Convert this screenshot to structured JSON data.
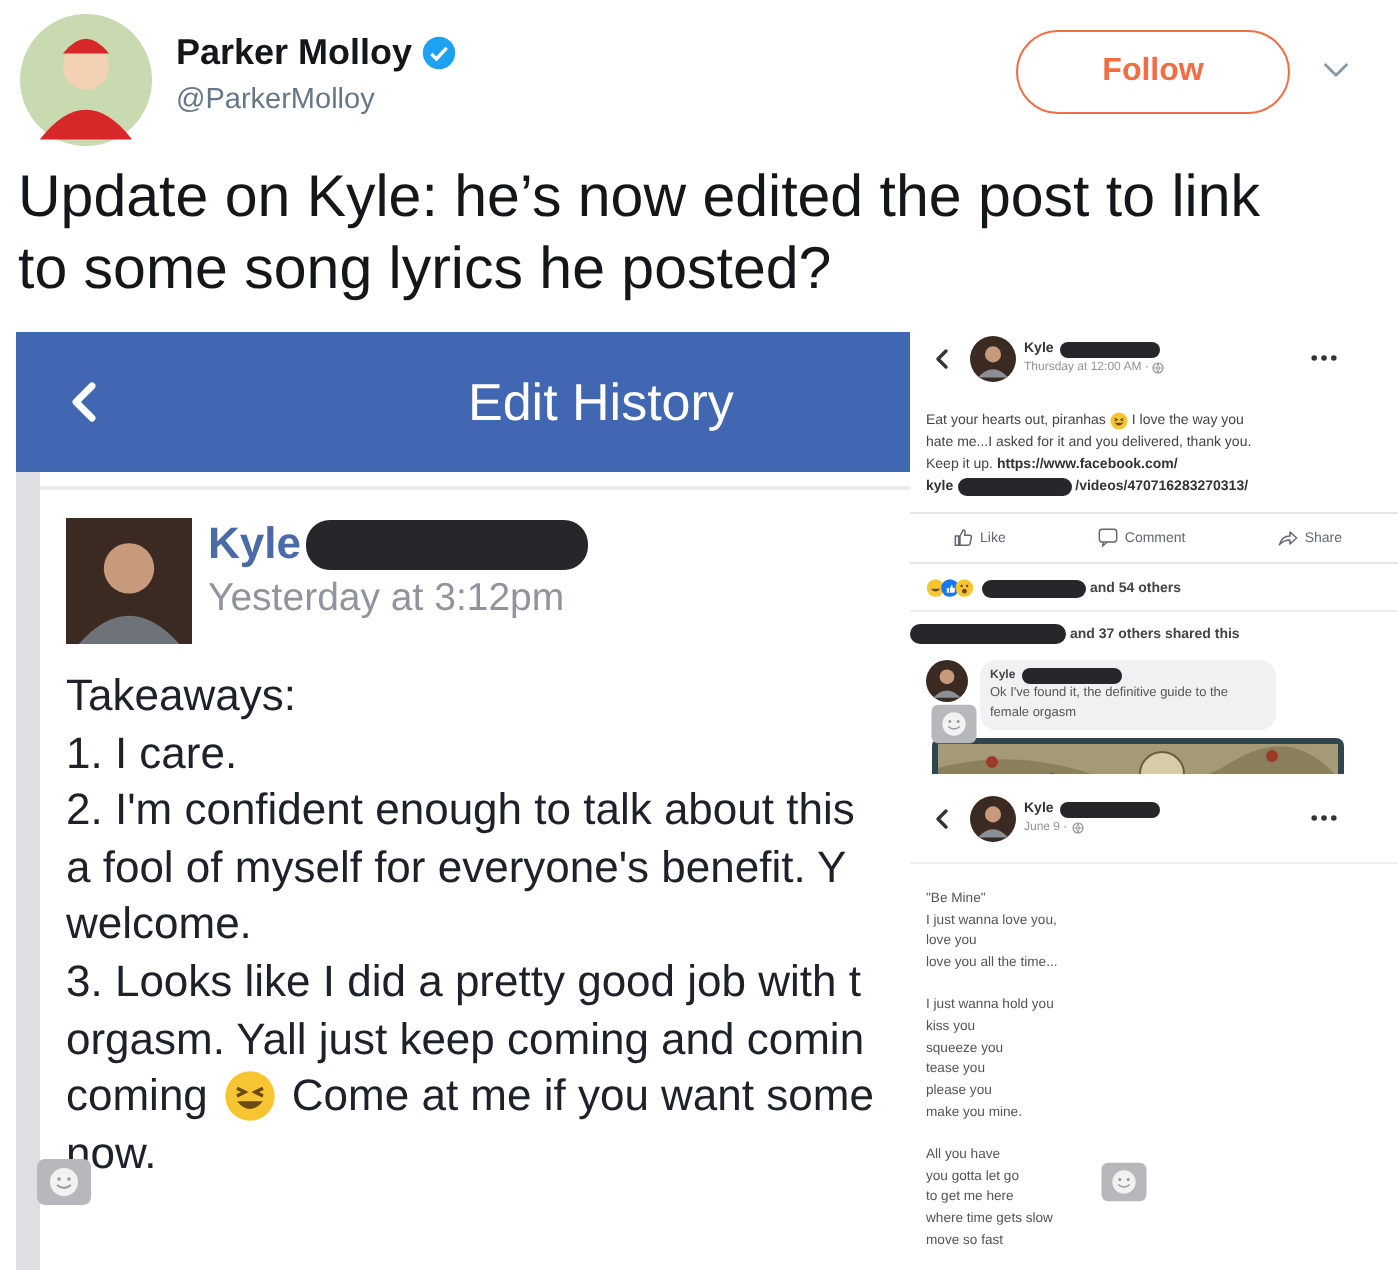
{
  "tweet": {
    "name": "Parker Molloy",
    "verified": true,
    "handle": "@ParkerMolloy",
    "follow": "Follow",
    "text": "Update on Kyle: he’s now edited the post to link to some song lyrics he posted?"
  },
  "edit_history": {
    "title": "Edit History",
    "author": {
      "name": "Kyle",
      "redacted": true
    },
    "time": "Yesterday at 3:12pm",
    "lines": [
      [
        {
          "kind": "text",
          "text": "Takeaways:"
        }
      ],
      [
        {
          "kind": "text",
          "text": "1. I care."
        }
      ],
      [
        {
          "kind": "text",
          "text": "2. I'm confident enough to talk about this"
        }
      ],
      [
        {
          "kind": "text",
          "text": "a fool of myself for everyone's benefit. Y"
        }
      ],
      [
        {
          "kind": "text",
          "text": "welcome."
        }
      ],
      [
        {
          "kind": "text",
          "text": "3. Looks like I did a pretty good job with t"
        }
      ],
      [
        {
          "kind": "text",
          "text": "orgasm. Yall just keep coming and comin"
        }
      ],
      [
        {
          "kind": "text",
          "text": "coming"
        },
        {
          "kind": "emoji"
        },
        {
          "kind": "text",
          "text": "Come at me if you want some"
        }
      ],
      [
        {
          "kind": "text",
          "text": "now."
        }
      ]
    ]
  },
  "post_screenshot": {
    "author": {
      "name": "Kyle",
      "redacted": true
    },
    "time": "Thursday at 12:00 AM ·",
    "lines": [
      [
        {
          "kind": "text",
          "text": "Eat your hearts out, piranhas"
        },
        {
          "kind": "emoji"
        },
        {
          "kind": "text",
          "text": "I love the way you"
        }
      ],
      [
        {
          "kind": "text",
          "text": "hate me...I asked for it and you delivered, thank you."
        }
      ],
      [
        {
          "kind": "text",
          "text": "Keep it up."
        },
        {
          "kind": "link",
          "text": "https://www.facebook.com/"
        }
      ],
      [
        {
          "kind": "link",
          "text": "kyle"
        },
        {
          "kind": "redaction"
        },
        {
          "kind": "link",
          "text": "/videos/470716283270313/"
        }
      ]
    ],
    "actions": [
      "Like",
      "Comment",
      "Share"
    ],
    "reactions": [
      {
        "kind": "reactions"
      },
      {
        "kind": "redaction"
      },
      {
        "kind": "text",
        "text": "and 54 others"
      }
    ],
    "shares": [
      {
        "kind": "redaction"
      },
      {
        "kind": "text",
        "text": "and 37 others shared this"
      }
    ],
    "comment": {
      "author": {
        "name": "Kyle",
        "redacted": true
      },
      "text": "Ok I've found it, the definitive guide to the female orgasm"
    }
  },
  "lyrics_screenshot": {
    "author": {
      "name": "Kyle",
      "redacted": true
    },
    "time": "June 9 ·",
    "stanzas": [
      [
        "\"Be Mine\"",
        "I just wanna love you,",
        "love you",
        "love you all the time..."
      ],
      [
        "I just wanna hold you",
        "kiss you",
        "squeeze you",
        "tease you",
        "please you",
        "make you mine."
      ],
      [
        "All you have",
        "you gotta let go",
        "to get me here",
        "where time gets slow",
        "move so fast"
      ]
    ]
  }
}
